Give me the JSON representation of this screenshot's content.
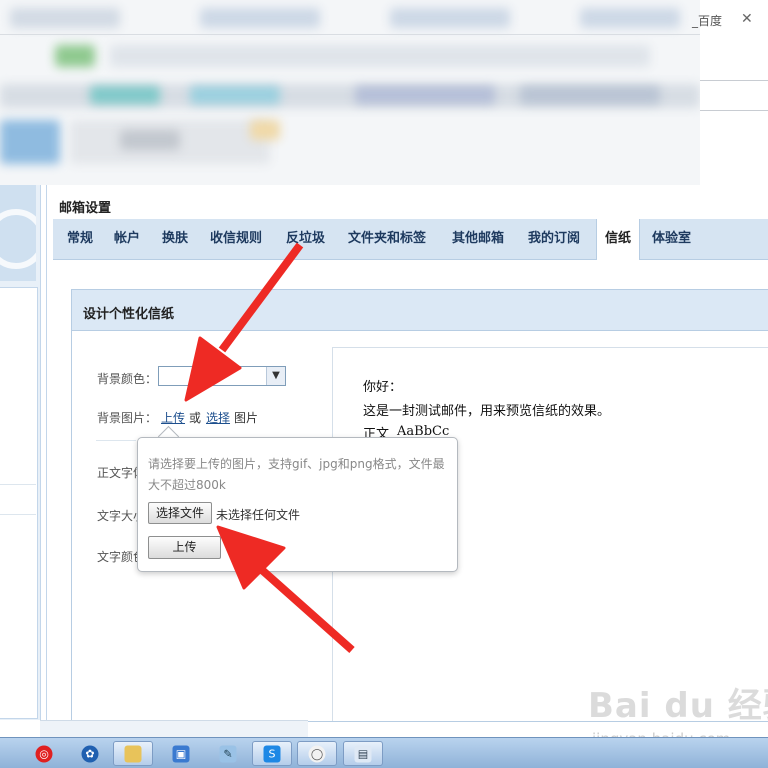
{
  "browser": {
    "tab_title_fragment": "_百度",
    "close_glyph": "✕"
  },
  "settings": {
    "title": "邮箱设置",
    "tabs": [
      {
        "label": "常规"
      },
      {
        "label": "帐户"
      },
      {
        "label": "换肤"
      },
      {
        "label": "收信规则"
      },
      {
        "label": "反垃圾"
      },
      {
        "label": "文件夹和标签"
      },
      {
        "label": "其他邮箱"
      },
      {
        "label": "我的订阅"
      },
      {
        "label": "信纸",
        "active": true
      },
      {
        "label": "体验室"
      }
    ]
  },
  "stationery": {
    "panel_title": "设计个性化信纸",
    "bg_color_label": "背景颜色：",
    "bg_color_value": "",
    "bg_image_label": "背景图片：",
    "upload_link": "上传",
    "or_text": "或",
    "choose_link": "选择",
    "image_text": "图片",
    "font_label_partial": "正文字体",
    "size_label_partial": "文字大小",
    "color_label_partial": "文字颜色"
  },
  "upload_popup": {
    "hint_line1": "请选择要上传的图片，支持gif、jpg和png格式，文件最",
    "hint_line2": "大不超过800k",
    "choose_file_button": "选择文件",
    "no_file_text": "未选择任何文件",
    "upload_button": "上传"
  },
  "preview": {
    "greeting": "你好：",
    "body": "这是一封测试邮件，用来预览信纸的效果。",
    "sample_prefix": "正文",
    "sample_latin": "AaBbCc"
  },
  "watermark": {
    "logo": "Bai du 经验",
    "url": "jingyan.baidu.com"
  },
  "colors": {
    "tab_bar_bg": "#d6e4f2",
    "panel_header_bg": "#dbe8f5",
    "link_color": "#1d4f8e",
    "arrow_red": "#ee2a24"
  },
  "taskbar": {
    "icons": [
      "record-icon",
      "media-player-icon",
      "file-explorer-icon",
      "image-viewer-icon",
      "paint-icon",
      "sogou-input-icon",
      "chat-icon",
      "notepad-icon"
    ]
  }
}
